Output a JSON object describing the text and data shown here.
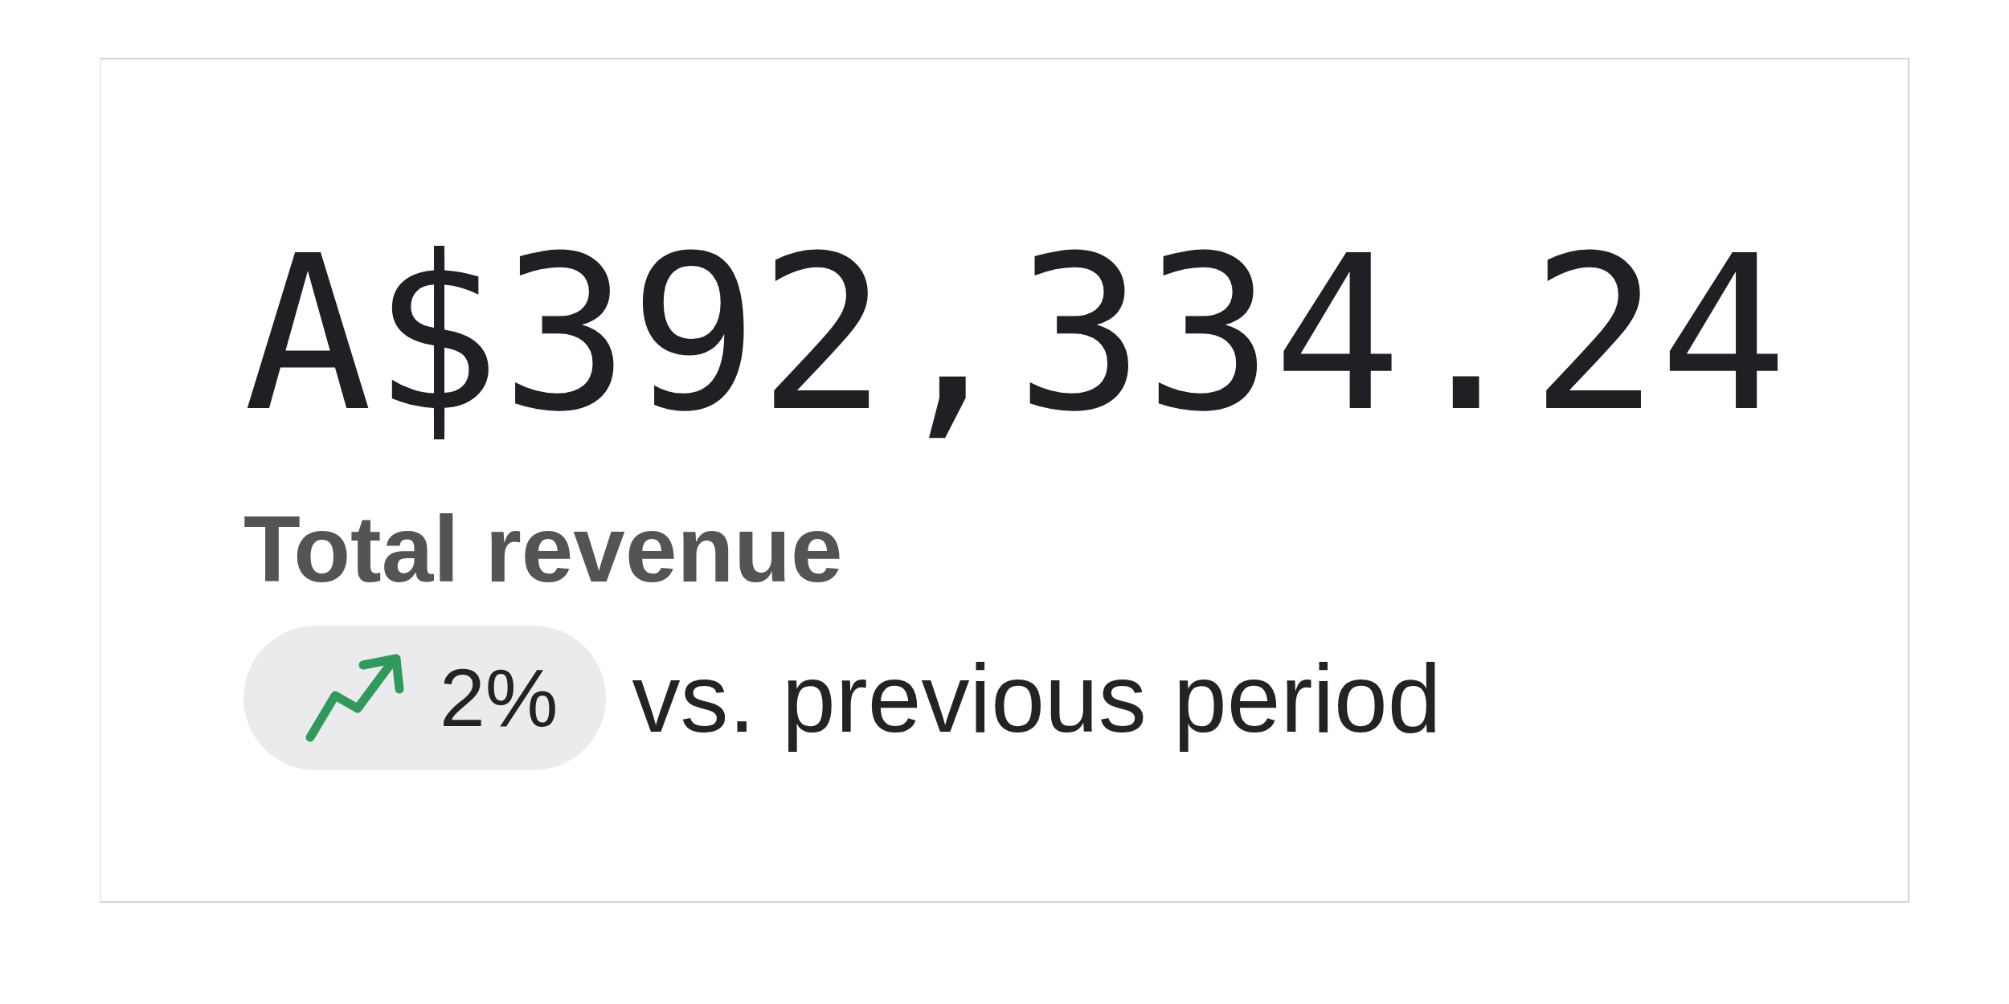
{
  "metric": {
    "value": "A$392,334.24",
    "label": "Total revenue",
    "change": {
      "rising": true,
      "text": "2%"
    },
    "comparison": "vs. previous period"
  }
}
